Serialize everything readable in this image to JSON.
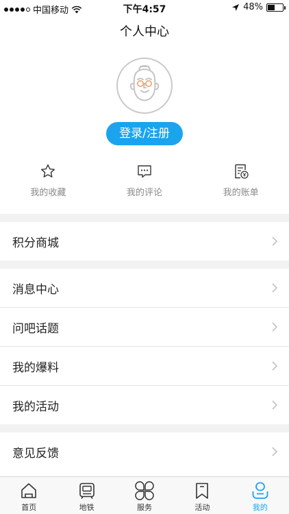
{
  "status_bar": {
    "carrier": "中国移动",
    "time": "下午4:57",
    "battery": "48%",
    "battery_level": 0.48
  },
  "header": {
    "title": "个人中心"
  },
  "profile": {
    "login_label": "登录/注册",
    "avatar_icon": "cartoon-avatar-icon"
  },
  "quick_actions": [
    {
      "label": "我的收藏",
      "icon": "star-icon"
    },
    {
      "label": "我的评论",
      "icon": "comment-icon"
    },
    {
      "label": "我的账单",
      "icon": "bill-icon"
    }
  ],
  "menu": {
    "points_mall": "积分商城",
    "messages": "消息中心",
    "ask_topics": "问吧话题",
    "my_reports": "我的爆料",
    "my_activities": "我的活动",
    "feedback": "意见反馈"
  },
  "tabs": [
    {
      "label": "首页",
      "icon": "home-icon"
    },
    {
      "label": "地铁",
      "icon": "metro-icon"
    },
    {
      "label": "服务",
      "icon": "service-icon"
    },
    {
      "label": "活动",
      "icon": "bookmark-icon"
    },
    {
      "label": "我的",
      "icon": "profile-icon",
      "active": true
    }
  ],
  "colors": {
    "accent": "#1aa4ee",
    "background": "#ffffff",
    "section_gap": "#f2f2f2",
    "muted_text": "#888888"
  }
}
